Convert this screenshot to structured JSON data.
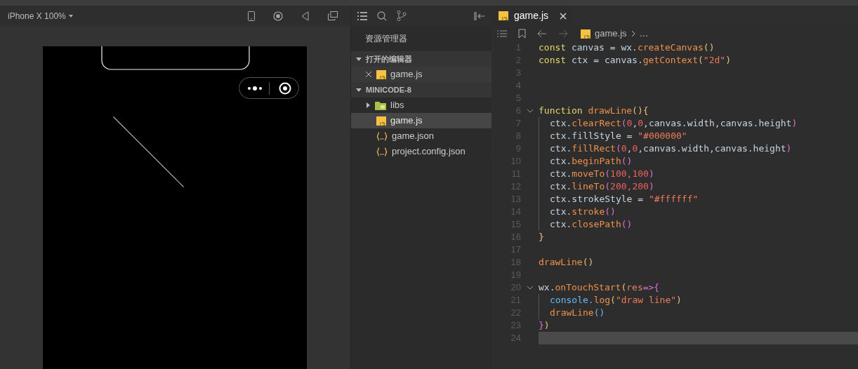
{
  "simulator": {
    "device": "iPhone X 100%"
  },
  "explorer": {
    "title": "资源管理器",
    "sections": [
      {
        "label": "打开的编辑器",
        "expanded": true,
        "items": [
          {
            "kind": "js",
            "name": "game.js",
            "closable": true,
            "selected": false,
            "hovered": true
          }
        ]
      },
      {
        "label": "MINICODE-8",
        "expanded": true,
        "items": [
          {
            "kind": "folder",
            "name": "libs",
            "expanded": false,
            "selected": false
          },
          {
            "kind": "js",
            "name": "game.js",
            "selected": true
          },
          {
            "kind": "json",
            "name": "game.json",
            "selected": false
          },
          {
            "kind": "json",
            "name": "project.config.json",
            "selected": false
          }
        ]
      }
    ]
  },
  "editor": {
    "tab": {
      "label": "game.js",
      "selected": true
    },
    "breadcrumb": {
      "file": "game.js",
      "more": "…"
    },
    "lines": [
      {
        "num": "1",
        "tokens": [
          {
            "text": "const",
            "kind": "keyword"
          },
          {
            "text": " canvas = wx.",
            "kind": "ident"
          },
          {
            "text": "createCanvas",
            "kind": "method"
          },
          {
            "text": "()",
            "kind": "paren1"
          }
        ]
      },
      {
        "num": "2",
        "tokens": [
          {
            "text": "const",
            "kind": "keyword"
          },
          {
            "text": " ctx = canvas.",
            "kind": "ident"
          },
          {
            "text": "getContext",
            "kind": "method"
          },
          {
            "text": "(",
            "kind": "paren1"
          },
          {
            "text": "\"2d\"",
            "kind": "string"
          },
          {
            "text": ")",
            "kind": "paren1"
          }
        ]
      },
      {
        "num": "3"
      },
      {
        "num": "4"
      },
      {
        "num": "5"
      },
      {
        "num": "6",
        "fold": true,
        "tokens": [
          {
            "text": "function ",
            "kind": "keyword"
          },
          {
            "text": "drawLine",
            "kind": "method"
          },
          {
            "text": "(){",
            "kind": "paren1"
          }
        ],
        "children": [
          {
            "num": "7",
            "tokens": [
              {
                "text": "ctx.",
                "kind": "ident"
              },
              {
                "text": "clearRect",
                "kind": "method"
              },
              {
                "text": "(",
                "kind": "paren2"
              },
              {
                "text": "0",
                "kind": "number"
              },
              {
                "text": ",",
                "kind": "ident"
              },
              {
                "text": "0",
                "kind": "number"
              },
              {
                "text": ",canvas.width,canvas.height",
                "kind": "ident"
              },
              {
                "text": ")",
                "kind": "paren2"
              }
            ]
          },
          {
            "num": "8",
            "tokens": [
              {
                "text": "ctx.fillStyle = ",
                "kind": "ident"
              },
              {
                "text": "\"#000000\"",
                "kind": "string"
              }
            ]
          },
          {
            "num": "9",
            "tokens": [
              {
                "text": "ctx.",
                "kind": "ident"
              },
              {
                "text": "fillRect",
                "kind": "method"
              },
              {
                "text": "(",
                "kind": "paren2"
              },
              {
                "text": "0",
                "kind": "number"
              },
              {
                "text": ",",
                "kind": "ident"
              },
              {
                "text": "0",
                "kind": "number"
              },
              {
                "text": ",canvas.width,canvas.height",
                "kind": "ident"
              },
              {
                "text": ")",
                "kind": "paren2"
              }
            ]
          },
          {
            "num": "10",
            "tokens": [
              {
                "text": "ctx.",
                "kind": "ident"
              },
              {
                "text": "beginPath",
                "kind": "method"
              },
              {
                "text": "()",
                "kind": "paren2"
              }
            ]
          },
          {
            "num": "11",
            "tokens": [
              {
                "text": "ctx.",
                "kind": "ident"
              },
              {
                "text": "moveTo",
                "kind": "method"
              },
              {
                "text": "(",
                "kind": "paren2"
              },
              {
                "text": "100,100",
                "kind": "number"
              },
              {
                "text": ")",
                "kind": "paren2"
              }
            ]
          },
          {
            "num": "12",
            "tokens": [
              {
                "text": "ctx.",
                "kind": "ident"
              },
              {
                "text": "lineTo",
                "kind": "method"
              },
              {
                "text": "(",
                "kind": "paren2"
              },
              {
                "text": "200,200",
                "kind": "number"
              },
              {
                "text": ")",
                "kind": "paren2"
              }
            ]
          },
          {
            "num": "13",
            "tokens": [
              {
                "text": "ctx.strokeStyle = ",
                "kind": "ident"
              },
              {
                "text": "\"#ffffff\"",
                "kind": "string"
              }
            ]
          },
          {
            "num": "14",
            "tokens": [
              {
                "text": "ctx.",
                "kind": "ident"
              },
              {
                "text": "stroke",
                "kind": "method"
              },
              {
                "text": "()",
                "kind": "paren2"
              }
            ]
          },
          {
            "num": "15",
            "tokens": [
              {
                "text": "ctx.",
                "kind": "ident"
              },
              {
                "text": "closePath",
                "kind": "method"
              },
              {
                "text": "()",
                "kind": "paren2"
              }
            ]
          }
        ]
      },
      {
        "num": "16",
        "tokens": [
          {
            "text": "}",
            "kind": "paren1"
          }
        ]
      },
      {
        "num": "17"
      },
      {
        "num": "18",
        "tokens": [
          {
            "text": "drawLine",
            "kind": "method"
          },
          {
            "text": "()",
            "kind": "paren1"
          }
        ]
      },
      {
        "num": "19"
      },
      {
        "num": "20",
        "fold": true,
        "tokens": [
          {
            "text": "wx.",
            "kind": "ident"
          },
          {
            "text": "onTouchStart",
            "kind": "method"
          },
          {
            "text": "(",
            "kind": "paren1"
          },
          {
            "text": "res",
            "kind": "param"
          },
          {
            "text": "=>{",
            "kind": "paren2"
          }
        ],
        "children": [
          {
            "num": "21",
            "tokens": [
              {
                "text": "console.",
                "kind": "builtin"
              },
              {
                "text": "log",
                "kind": "method"
              },
              {
                "text": "(",
                "kind": "paren1"
              },
              {
                "text": "\"draw line\"",
                "kind": "string"
              },
              {
                "text": ")",
                "kind": "paren1"
              }
            ]
          },
          {
            "num": "22",
            "tokens": [
              {
                "text": "drawLine",
                "kind": "method"
              },
              {
                "text": "()",
                "kind": "paren3"
              }
            ]
          }
        ]
      },
      {
        "num": "23",
        "tokens": [
          {
            "text": "}",
            "kind": "paren2"
          },
          {
            "text": ")",
            "kind": "paren1"
          }
        ]
      },
      {
        "num": "24",
        "current": true
      }
    ]
  }
}
